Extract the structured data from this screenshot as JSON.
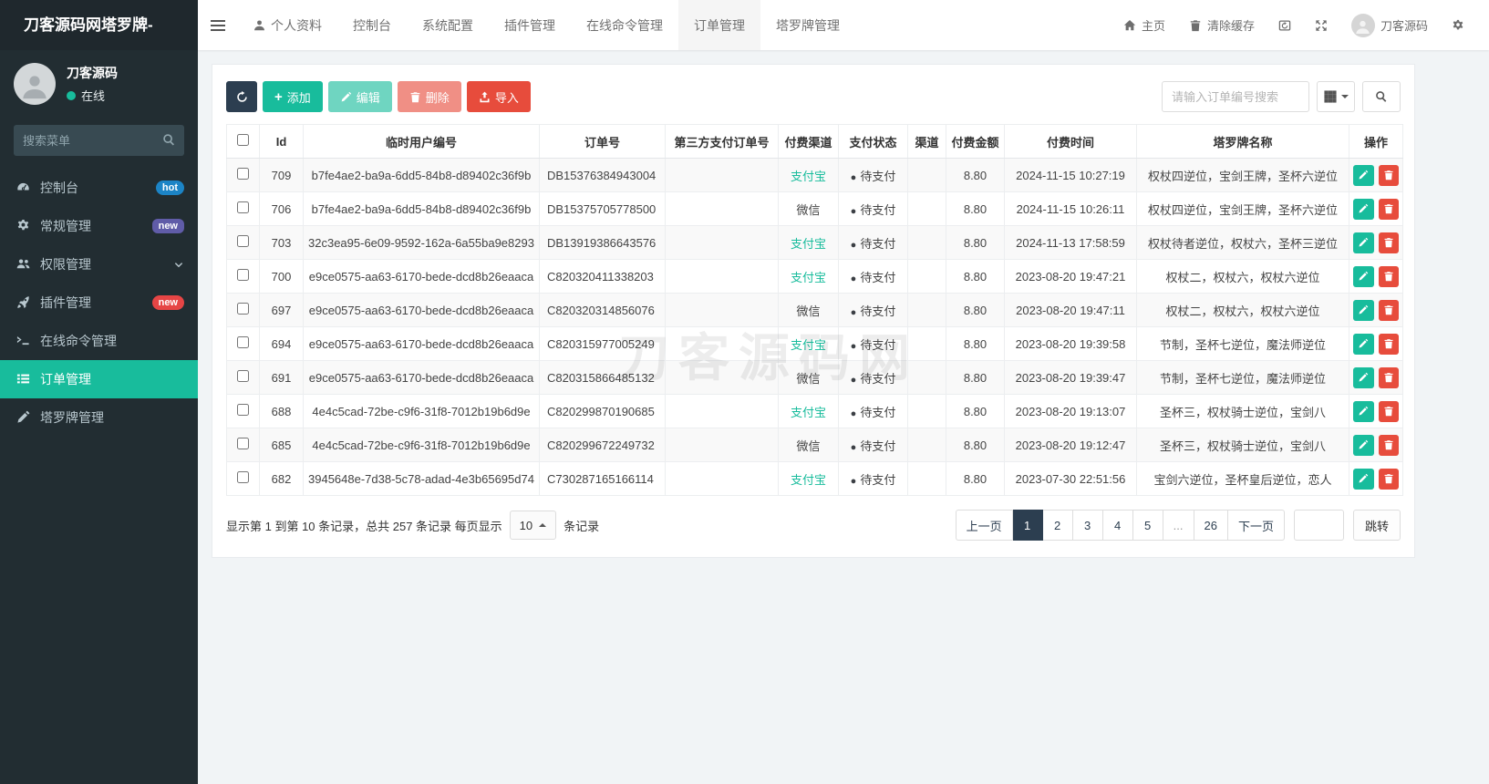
{
  "colors": {
    "accent_teal": "#18bc9c",
    "danger_red": "#e74c3c",
    "dark_navy": "#2c3e50",
    "sidebar_bg": "#222d32",
    "badge_hot_blue": "#1c84c6",
    "badge_new_purple": "#605ca8",
    "badge_new_red": "#e64545"
  },
  "brand": {
    "title": "刀客源码网塔罗牌-"
  },
  "topnav": {
    "items": [
      {
        "key": "profile",
        "label": "个人资料",
        "icon": "user",
        "active": false
      },
      {
        "key": "dashboard",
        "label": "控制台",
        "active": false
      },
      {
        "key": "config",
        "label": "系统配置",
        "active": false
      },
      {
        "key": "addon",
        "label": "插件管理",
        "active": false
      },
      {
        "key": "command",
        "label": "在线命令管理",
        "active": false
      },
      {
        "key": "order",
        "label": "订单管理",
        "active": true
      },
      {
        "key": "tarot",
        "label": "塔罗牌管理",
        "active": false
      }
    ],
    "right": {
      "home": "主页",
      "clear_cache": "清除缓存",
      "username": "刀客源码"
    }
  },
  "sidebar": {
    "user": {
      "name": "刀客源码",
      "status": "在线"
    },
    "search_placeholder": "搜索菜单",
    "menu": [
      {
        "key": "dashboard",
        "label": "控制台",
        "icon": "gauge",
        "badge": "hot",
        "badge_style": "blue"
      },
      {
        "key": "general",
        "label": "常规管理",
        "icon": "cogs",
        "badge": "new",
        "badge_style": "purple"
      },
      {
        "key": "auth",
        "label": "权限管理",
        "icon": "users",
        "chevron": true
      },
      {
        "key": "addon",
        "label": "插件管理",
        "icon": "rocket",
        "badge": "new",
        "badge_style": "red"
      },
      {
        "key": "command",
        "label": "在线命令管理",
        "icon": "terminal"
      },
      {
        "key": "order",
        "label": "订单管理",
        "icon": "list",
        "active": true
      },
      {
        "key": "tarot",
        "label": "塔罗牌管理",
        "icon": "pen"
      }
    ]
  },
  "toolbar": {
    "add": "添加",
    "edit": "编辑",
    "delete": "删除",
    "import": "导入"
  },
  "search": {
    "placeholder": "请输入订单编号搜索"
  },
  "table": {
    "headers": [
      "Id",
      "临时用户编号",
      "订单号",
      "第三方支付订单号",
      "付费渠道",
      "支付状态",
      "渠道",
      "付费金额",
      "付费时间",
      "塔罗牌名称",
      "操作"
    ],
    "rows": [
      {
        "id": "709",
        "user_no": "b7fe4ae2-ba9a-6dd5-84b8-d89402c36f9b",
        "order_no": "DB15376384943004",
        "third_no": "",
        "channel": "支付宝",
        "channel_style": "link",
        "status": "待支付",
        "sub_channel": "",
        "amount": "8.80",
        "time": "2024-11-15 10:27:19",
        "tarot": "权杖四逆位，宝剑王牌，圣杯六逆位"
      },
      {
        "id": "706",
        "user_no": "b7fe4ae2-ba9a-6dd5-84b8-d89402c36f9b",
        "order_no": "DB15375705778500",
        "third_no": "",
        "channel": "微信",
        "channel_style": "plain",
        "status": "待支付",
        "sub_channel": "",
        "amount": "8.80",
        "time": "2024-11-15 10:26:11",
        "tarot": "权杖四逆位，宝剑王牌，圣杯六逆位"
      },
      {
        "id": "703",
        "user_no": "32c3ea95-6e09-9592-162a-6a55ba9e8293",
        "order_no": "DB13919386643576",
        "third_no": "",
        "channel": "支付宝",
        "channel_style": "link",
        "status": "待支付",
        "sub_channel": "",
        "amount": "8.80",
        "time": "2024-11-13 17:58:59",
        "tarot": "权杖待者逆位，权杖六，圣杯三逆位"
      },
      {
        "id": "700",
        "user_no": "e9ce0575-aa63-6170-bede-dcd8b26eaaca",
        "order_no": "C820320411338203",
        "third_no": "",
        "channel": "支付宝",
        "channel_style": "link",
        "status": "待支付",
        "sub_channel": "",
        "amount": "8.80",
        "time": "2023-08-20 19:47:21",
        "tarot": "权杖二，权杖六，权杖六逆位"
      },
      {
        "id": "697",
        "user_no": "e9ce0575-aa63-6170-bede-dcd8b26eaaca",
        "order_no": "C820320314856076",
        "third_no": "",
        "channel": "微信",
        "channel_style": "plain",
        "status": "待支付",
        "sub_channel": "",
        "amount": "8.80",
        "time": "2023-08-20 19:47:11",
        "tarot": "权杖二，权杖六，权杖六逆位"
      },
      {
        "id": "694",
        "user_no": "e9ce0575-aa63-6170-bede-dcd8b26eaaca",
        "order_no": "C820315977005249",
        "third_no": "",
        "channel": "支付宝",
        "channel_style": "link",
        "status": "待支付",
        "sub_channel": "",
        "amount": "8.80",
        "time": "2023-08-20 19:39:58",
        "tarot": "节制，圣杯七逆位，魔法师逆位"
      },
      {
        "id": "691",
        "user_no": "e9ce0575-aa63-6170-bede-dcd8b26eaaca",
        "order_no": "C820315866485132",
        "third_no": "",
        "channel": "微信",
        "channel_style": "plain",
        "status": "待支付",
        "sub_channel": "",
        "amount": "8.80",
        "time": "2023-08-20 19:39:47",
        "tarot": "节制，圣杯七逆位，魔法师逆位"
      },
      {
        "id": "688",
        "user_no": "4e4c5cad-72be-c9f6-31f8-7012b19b6d9e",
        "order_no": "C820299870190685",
        "third_no": "",
        "channel": "支付宝",
        "channel_style": "link",
        "status": "待支付",
        "sub_channel": "",
        "amount": "8.80",
        "time": "2023-08-20 19:13:07",
        "tarot": "圣杯三，权杖骑士逆位，宝剑八"
      },
      {
        "id": "685",
        "user_no": "4e4c5cad-72be-c9f6-31f8-7012b19b6d9e",
        "order_no": "C820299672249732",
        "third_no": "",
        "channel": "微信",
        "channel_style": "plain",
        "status": "待支付",
        "sub_channel": "",
        "amount": "8.80",
        "time": "2023-08-20 19:12:47",
        "tarot": "圣杯三，权杖骑士逆位，宝剑八"
      },
      {
        "id": "682",
        "user_no": "3945648e-7d38-5c78-adad-4e3b65695d74",
        "order_no": "C730287165166114",
        "third_no": "",
        "channel": "支付宝",
        "channel_style": "link",
        "status": "待支付",
        "sub_channel": "",
        "amount": "8.80",
        "time": "2023-07-30 22:51:56",
        "tarot": "宝剑六逆位，圣杯皇后逆位，恋人"
      }
    ]
  },
  "watermark": "刀客源码网",
  "pagination": {
    "info_prefix": "显示第 1 到第 10 条记录，总共 257 条记录 每页显示",
    "page_size": "10",
    "info_suffix": "条记录",
    "pages": [
      "上一页",
      "1",
      "2",
      "3",
      "4",
      "5",
      "...",
      "26",
      "下一页"
    ],
    "active_page": "1",
    "jump_label": "跳转"
  }
}
